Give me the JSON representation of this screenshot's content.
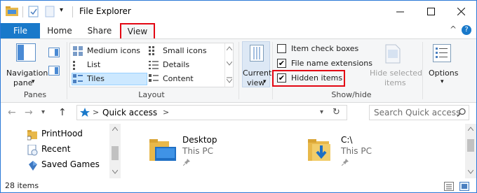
{
  "window": {
    "title": "File Explorer",
    "accent_color": "#1979ca",
    "highlight_color": "#e30613"
  },
  "titlebar": {
    "minimize_icon": "minimize-icon",
    "maximize_icon": "maximize-icon",
    "close_icon": "close-icon",
    "qat_dropdown_glyph": "▾"
  },
  "tabs": {
    "file": "File",
    "home": "Home",
    "share": "Share",
    "view": "View",
    "collapse_glyph": "^",
    "help_glyph": "?"
  },
  "ribbon": {
    "panes": {
      "navigation_pane_label": "Navigation",
      "navigation_pane_label2": "pane",
      "dropdown_glyph": "▾",
      "group_label": "Panes"
    },
    "layout": {
      "group_label": "Layout",
      "options": [
        {
          "label": "Medium icons",
          "selected": false
        },
        {
          "label": "Small icons",
          "selected": false
        },
        {
          "label": "List",
          "selected": false
        },
        {
          "label": "Details",
          "selected": false
        },
        {
          "label": "Tiles",
          "selected": true
        },
        {
          "label": "Content",
          "selected": false
        }
      ]
    },
    "current_view": {
      "label": "Current",
      "label2": "view",
      "dropdown_glyph": "▾"
    },
    "show_hide": {
      "group_label": "Show/hide",
      "checkboxes": [
        {
          "label": "Item check boxes",
          "checked": false
        },
        {
          "label": "File name extensions",
          "checked": true
        },
        {
          "label": "Hidden items",
          "checked": true
        }
      ],
      "check_glyph": "✔",
      "hide_selected_label": "Hide selected",
      "hide_selected_label2": "items"
    },
    "options": {
      "label": "Options",
      "dropdown_glyph": "▾"
    }
  },
  "address": {
    "back_glyph": "←",
    "forward_glyph": "→",
    "recent_glyph": "▾",
    "up_glyph": "↑",
    "sep_glyph": ">",
    "location": "Quick access",
    "trail_glyph": ">",
    "dropdown_glyph": "▾",
    "refresh_glyph": "↻",
    "search_placeholder": "Search Quick access"
  },
  "nav_pane": {
    "items": [
      {
        "label": "PrintHood",
        "icon": "shortcut-folder-icon"
      },
      {
        "label": "Recent",
        "icon": "recent-files-icon"
      },
      {
        "label": "Saved Games",
        "icon": "saved-games-icon"
      }
    ]
  },
  "content": {
    "tiles": [
      {
        "name": "Desktop",
        "location": "This PC",
        "icon": "desktop-folder-icon"
      },
      {
        "name": "C:\\",
        "location": "This PC",
        "icon": "downloads-folder-icon"
      }
    ]
  },
  "status": {
    "count": "28 items"
  }
}
